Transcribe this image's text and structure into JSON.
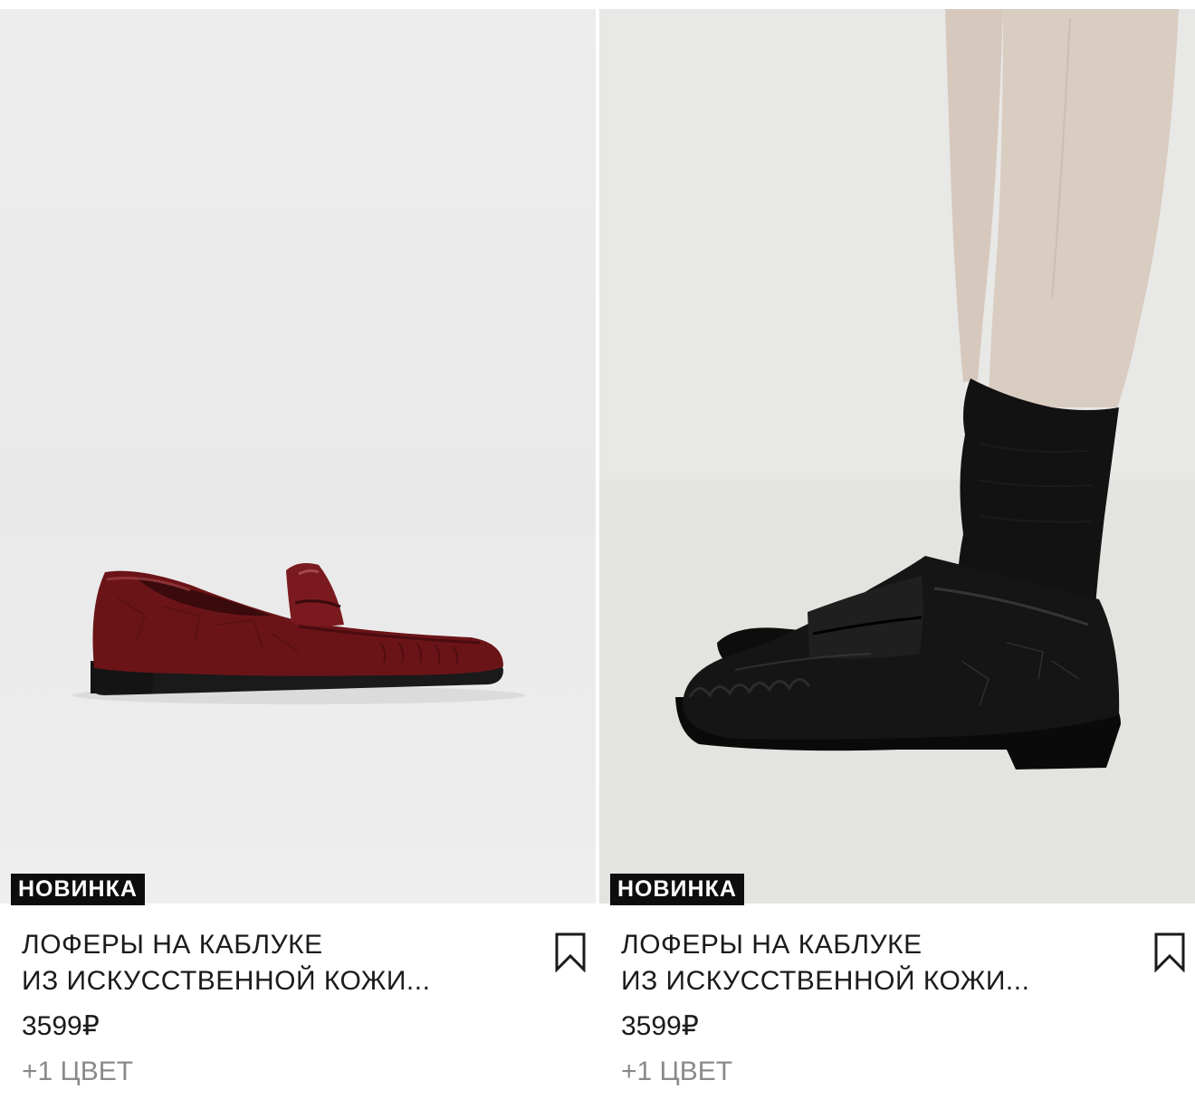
{
  "products": [
    {
      "badge": "НОВИНКА",
      "title_line1": "ЛОФЕРЫ НА КАБЛУКЕ",
      "title_line2": "ИЗ ИСКУССТВЕННОЙ КОЖИ...",
      "price": "3599₽",
      "colors": "+1 ЦВЕТ",
      "shoe_color": "#6b1418"
    },
    {
      "badge": "НОВИНКА",
      "title_line1": "ЛОФЕРЫ НА КАБЛУКЕ",
      "title_line2": "ИЗ ИСКУССТВЕННОЙ КОЖИ...",
      "price": "3599₽",
      "colors": "+1 ЦВЕТ",
      "shoe_color": "#111111"
    }
  ],
  "icons": {
    "bookmark": "bookmark-icon"
  }
}
